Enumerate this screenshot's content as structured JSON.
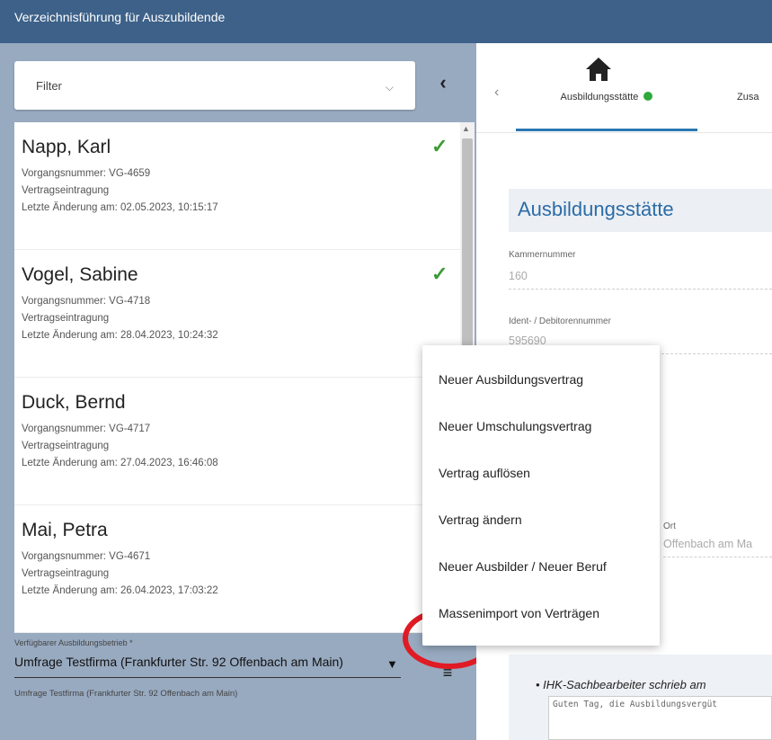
{
  "app": {
    "title": "Verzeichnisführung für Auszubildende"
  },
  "filter": {
    "label": "Filter"
  },
  "list": {
    "items": [
      {
        "name": "Napp, Karl",
        "number": "Vorgangsnummer: VG-4659",
        "type": "Vertragseintragung",
        "changed": "Letzte Änderung am: 02.05.2023, 10:15:17",
        "check": true
      },
      {
        "name": "Vogel, Sabine",
        "number": "Vorgangsnummer: VG-4718",
        "type": "Vertragseintragung",
        "changed": "Letzte Änderung am: 28.04.2023, 10:24:32",
        "check": true
      },
      {
        "name": "Duck, Bernd",
        "number": "Vorgangsnummer: VG-4717",
        "type": "Vertragseintragung",
        "changed": "Letzte Änderung am: 27.04.2023, 16:46:08",
        "check": false
      },
      {
        "name": "Mai, Petra",
        "number": "Vorgangsnummer: VG-4671",
        "type": "Vertragseintragung",
        "changed": "Letzte Änderung am: 26.04.2023, 17:03:22",
        "check": false
      }
    ]
  },
  "betrieb": {
    "label": "Verfügbarer Ausbildungsbetrieb *",
    "value": "Umfrage Testfirma (Frankfurter Str. 92 Offenbach am Main)",
    "hint": "Umfrage Testfirma (Frankfurter Str. 92 Offenbach am Main)"
  },
  "tabs": [
    {
      "label": "Ausbildungsstätte",
      "status_color": "#2eaa3b",
      "active": true
    },
    {
      "label": "Zusa",
      "active": false
    }
  ],
  "section": {
    "title": "Ausbildungsstätte",
    "fields": [
      {
        "label": "Kammernummer",
        "value": "160"
      },
      {
        "label": "Ident- / Debitorennummer",
        "value": "595690"
      },
      {
        "label": "Ort",
        "value": "Offenbach am Ma"
      }
    ]
  },
  "message": {
    "heading": "IHK-Sachbearbeiter schrieb am",
    "text": "Guten Tag, die Ausbildungsvergüt"
  },
  "menu": {
    "options": [
      "Neuer Ausbildungsvertrag",
      "Neuer Umschulungsvertrag",
      "Vertrag auflösen",
      "Vertrag ändern",
      "Neuer Ausbilder / Neuer Beruf",
      "Massenimport von Verträgen"
    ]
  },
  "colors": {
    "header": "#3d6189",
    "sidebar": "#98aac0",
    "accent": "#2b6ca8",
    "check": "#3c9b35",
    "annotation": "#e01b24"
  },
  "icons": [
    "home-icon",
    "check-icon",
    "chevron-left-icon",
    "chevron-down-icon",
    "hamburger-menu-icon"
  ]
}
